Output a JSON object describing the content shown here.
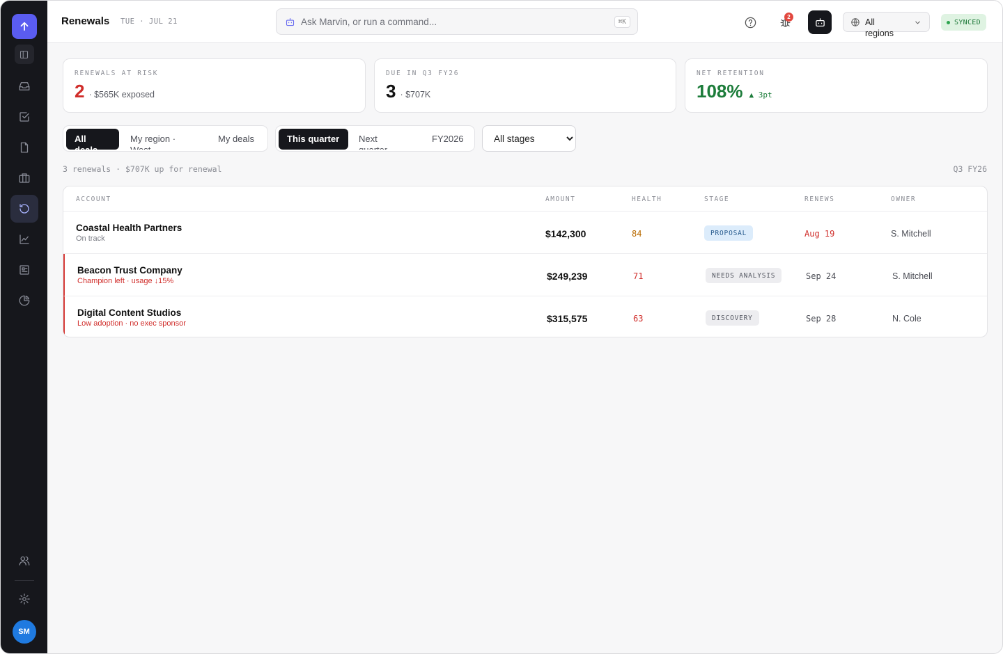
{
  "header": {
    "title": "Renewals",
    "date": "TUE · JUL 21",
    "command_placeholder": "Ask Marvin, or run a command...",
    "command_shortcut": "⌘K",
    "notification_count": "2",
    "region_label": "All regions",
    "sync_status": "SYNCED"
  },
  "sidebar": {
    "avatar_initials": "SM",
    "items": [
      {
        "icon": "inbox-icon"
      },
      {
        "icon": "task-check-icon"
      },
      {
        "icon": "document-icon"
      },
      {
        "icon": "briefcase-icon"
      },
      {
        "icon": "renewals-icon",
        "active": true
      },
      {
        "icon": "chart-icon"
      },
      {
        "icon": "contact-card-icon"
      },
      {
        "icon": "pie-chart-icon"
      }
    ]
  },
  "kpis": [
    {
      "label": "RENEWALS AT RISK",
      "value": "2",
      "sub": "· $565K exposed",
      "color": "#d02d2a"
    },
    {
      "label": "DUE IN Q3 FY26",
      "value": "3",
      "sub": "· $707K",
      "color": "#111111"
    },
    {
      "label": "NET RETENTION",
      "value": "108%",
      "delta": "▲ 3pt",
      "color": "#1c7c3a"
    }
  ],
  "filters": {
    "scope": [
      "All deals",
      "My region · West",
      "My deals"
    ],
    "scope_selected": "All deals",
    "period": [
      "This quarter",
      "Next quarter",
      "FY2026"
    ],
    "period_selected": "This quarter",
    "stage_selected": "All stages"
  },
  "summary": "3 renewals · $707K up for renewal",
  "period_label": "Q3 FY26",
  "table": {
    "columns": [
      "ACCOUNT",
      "AMOUNT",
      "HEALTH",
      "STAGE",
      "RENEWS",
      "OWNER"
    ],
    "rows": [
      {
        "account": "Coastal Health Partners",
        "note": "On track",
        "amount": "$142,300",
        "health": "84",
        "health_color": "#b86a00",
        "stage": "PROPOSAL",
        "stage_bg": "#dcecfb",
        "stage_color": "#2a5d8f",
        "renews": "Aug 19",
        "renews_color": "#d02d2a",
        "owner": "S. Mitchell",
        "at_risk": false
      },
      {
        "account": "Beacon Trust Company",
        "note": "Champion left · usage ↓15%",
        "amount": "$249,239",
        "health": "71",
        "health_color": "#d02d2a",
        "stage": "NEEDS ANALYSIS",
        "stage_bg": "#ededf0",
        "stage_color": "#555862",
        "renews": "Sep 24",
        "renews_color": "#4b4d55",
        "owner": "S. Mitchell",
        "at_risk": true
      },
      {
        "account": "Digital Content Studios",
        "note": "Low adoption · no exec sponsor",
        "amount": "$315,575",
        "health": "63",
        "health_color": "#d02d2a",
        "stage": "DISCOVERY",
        "stage_bg": "#ededf0",
        "stage_color": "#555862",
        "renews": "Sep 28",
        "renews_color": "#4b4d55",
        "owner": "N. Cole",
        "at_risk": true
      }
    ]
  }
}
